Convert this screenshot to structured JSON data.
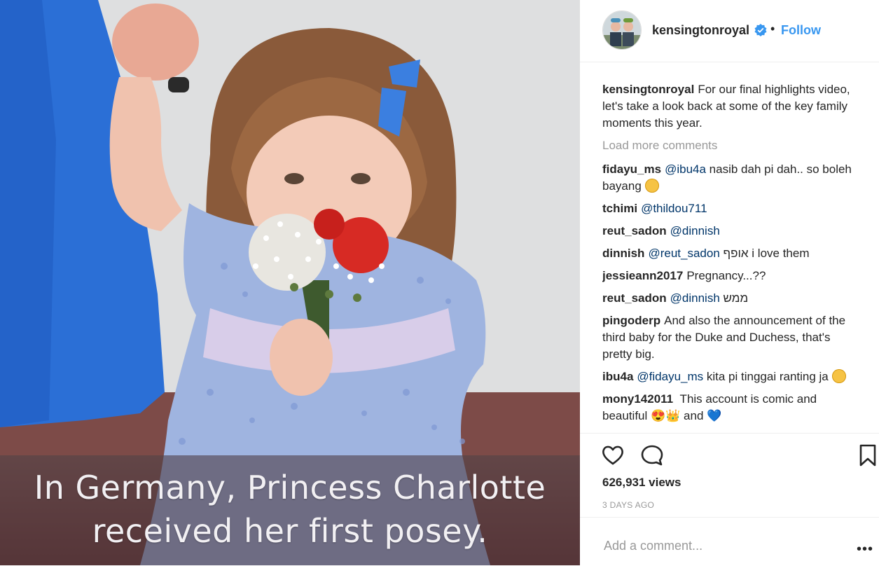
{
  "media": {
    "caption_line1": "In Germany, Princess Charlotte",
    "caption_line2": "received her first posey."
  },
  "header": {
    "username": "kensingtonroyal",
    "separator": "•",
    "follow_label": "Follow",
    "verified_icon": "verified-badge-icon"
  },
  "post": {
    "caption_user": "kensingtonroyal",
    "caption_text": "For our final highlights video, let's take a look back at some of the key family moments this year.",
    "load_more": "Load more comments",
    "comments": [
      {
        "user": "fidayu_ms",
        "mention": "@ibu4a",
        "text": " nasib dah pi dah.. so boleh bayang",
        "emoji": "smiling-face-emoji"
      },
      {
        "user": "tchimi",
        "mention": "@thildou711",
        "text": ""
      },
      {
        "user": "reut_sadon",
        "mention": "@dinnish",
        "text": ""
      },
      {
        "user": "dinnish",
        "mention": "@reut_sadon",
        "text": " אופף i love them"
      },
      {
        "user": "jessieann2017",
        "mention": "",
        "text": "Pregnancy...??"
      },
      {
        "user": "reut_sadon",
        "mention": "@dinnish",
        "text": " ממש"
      },
      {
        "user": "pingoderp",
        "mention": "",
        "text": "And also the announcement of the third baby for the Duke and Duchess, that's pretty big."
      },
      {
        "user": "ibu4a",
        "mention": "@fidayu_ms",
        "text": " kita pi tinggai ranting ja",
        "emoji": "laughing-tears-emoji"
      },
      {
        "user": "mony142011",
        "mention": "",
        "text": " This account is comic and beautiful 😍👑 and 💙"
      }
    ]
  },
  "actions": {
    "like_icon": "heart-icon",
    "comment_icon": "comment-bubble-icon",
    "save_icon": "bookmark-icon",
    "views": "626,931 views",
    "time": "3 DAYS AGO"
  },
  "add_comment": {
    "placeholder": "Add a comment...",
    "more_label": "•••"
  },
  "colors": {
    "link": "#3897f0",
    "mention": "#003569",
    "muted": "#999999"
  }
}
